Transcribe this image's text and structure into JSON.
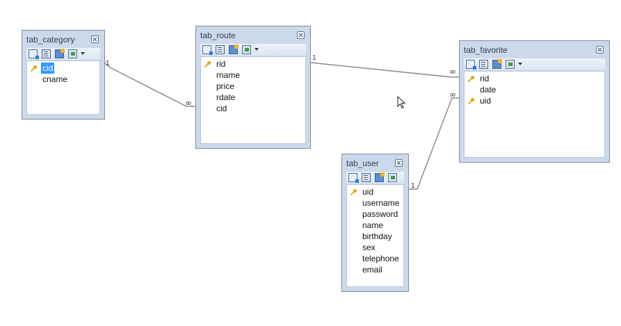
{
  "diagram": {
    "tables": [
      {
        "id": "tab_category",
        "title": "tab_category",
        "fields": [
          {
            "name": "cid",
            "key": true,
            "selected": true
          },
          {
            "name": "cname",
            "key": false,
            "selected": false
          }
        ]
      },
      {
        "id": "tab_route",
        "title": "tab_route",
        "fields": [
          {
            "name": "rid",
            "key": true,
            "selected": false
          },
          {
            "name": "rname",
            "key": false,
            "selected": false
          },
          {
            "name": "price",
            "key": false,
            "selected": false
          },
          {
            "name": "rdate",
            "key": false,
            "selected": false
          },
          {
            "name": "cid",
            "key": false,
            "selected": false
          }
        ]
      },
      {
        "id": "tab_favorite",
        "title": "tab_favorite",
        "fields": [
          {
            "name": "rid",
            "key": true,
            "selected": false
          },
          {
            "name": "date",
            "key": false,
            "selected": false
          },
          {
            "name": "uid",
            "key": true,
            "selected": false
          }
        ]
      },
      {
        "id": "tab_user",
        "title": "tab_user",
        "fields": [
          {
            "name": "uid",
            "key": true,
            "selected": false
          },
          {
            "name": "username",
            "key": false,
            "selected": false
          },
          {
            "name": "password",
            "key": false,
            "selected": false
          },
          {
            "name": "name",
            "key": false,
            "selected": false
          },
          {
            "name": "birthday",
            "key": false,
            "selected": false
          },
          {
            "name": "sex",
            "key": false,
            "selected": false
          },
          {
            "name": "telephone",
            "key": false,
            "selected": false
          },
          {
            "name": "email",
            "key": false,
            "selected": false
          }
        ]
      }
    ],
    "relationships": [
      {
        "from": "tab_category",
        "to": "tab_route",
        "from_label": "1",
        "to_label": "∞"
      },
      {
        "from": "tab_route",
        "to": "tab_favorite",
        "from_label": "1",
        "to_label": "∞"
      },
      {
        "from": "tab_user",
        "to": "tab_favorite",
        "from_label": "1",
        "to_label": "∞"
      }
    ],
    "colors": {
      "table_frame": "#ccd9ea",
      "table_border": "#7d8da6",
      "selection": "#3399ff",
      "key_icon": "#e5ac1b",
      "connector": "#8c8c8c"
    }
  }
}
